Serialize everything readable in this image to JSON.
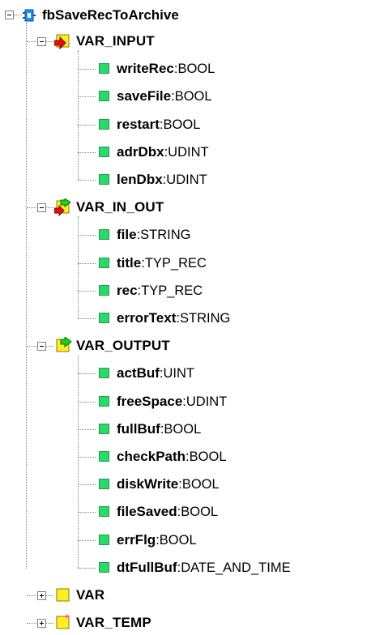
{
  "root": {
    "label": "fbSaveRecToArchive"
  },
  "sections": [
    {
      "label": "VAR_INPUT",
      "icon": "input-folder-icon",
      "expanded": true,
      "items": [
        {
          "name": "writeRec",
          "type": "BOOL"
        },
        {
          "name": "saveFile",
          "type": "BOOL"
        },
        {
          "name": "restart",
          "type": "BOOL"
        },
        {
          "name": "adrDbx",
          "type": "UDINT"
        },
        {
          "name": "lenDbx",
          "type": "UDINT"
        }
      ]
    },
    {
      "label": "VAR_IN_OUT",
      "icon": "inout-folder-icon",
      "expanded": true,
      "items": [
        {
          "name": "file",
          "type": "STRING"
        },
        {
          "name": "title",
          "type": "TYP_REC"
        },
        {
          "name": "rec",
          "type": "TYP_REC"
        },
        {
          "name": "errorText",
          "type": "STRING"
        }
      ]
    },
    {
      "label": "VAR_OUTPUT",
      "icon": "output-folder-icon",
      "expanded": true,
      "items": [
        {
          "name": "actBuf",
          "type": "UINT"
        },
        {
          "name": "freeSpace",
          "type": "UDINT"
        },
        {
          "name": "fullBuf",
          "type": "BOOL"
        },
        {
          "name": "checkPath",
          "type": "BOOL"
        },
        {
          "name": "diskWrite",
          "type": "BOOL"
        },
        {
          "name": "fileSaved",
          "type": "BOOL"
        },
        {
          "name": "errFlg",
          "type": "BOOL"
        },
        {
          "name": "dtFullBuf",
          "type": "DATE_AND_TIME"
        }
      ]
    },
    {
      "label": "VAR",
      "icon": "var-folder-icon",
      "expanded": false,
      "items": []
    },
    {
      "label": "VAR_TEMP",
      "icon": "temp-folder-icon",
      "expanded": false,
      "items": []
    }
  ],
  "separator": " : ",
  "colors": {
    "leaf": "#2bd96a",
    "folder": "#ffee22",
    "arrow_red": "#e01010",
    "arrow_green": "#22cc22",
    "root_blue": "#1e8ff0",
    "temp_star": "#ff33ff"
  }
}
